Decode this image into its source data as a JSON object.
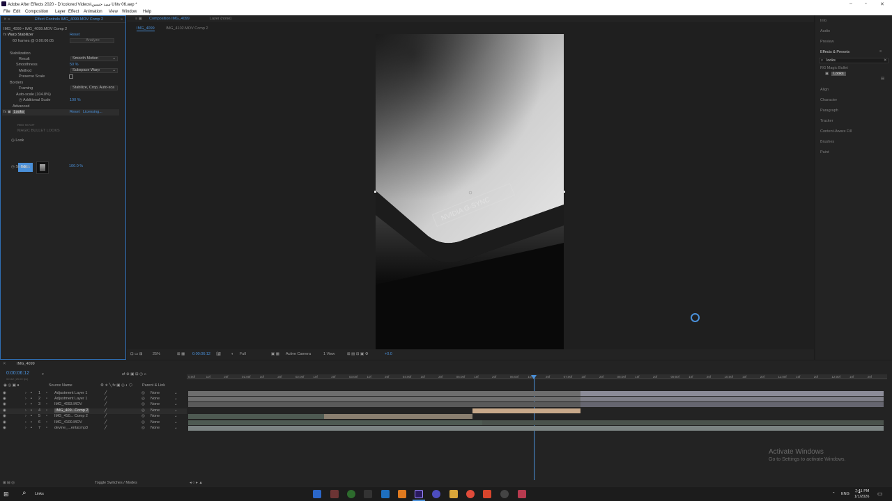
{
  "window": {
    "title": "Adobe After Effects 2020 - D:\\colored Videos\\سيد حسين UI\\tv 06.aep *"
  },
  "menu": [
    "File",
    "Edit",
    "Composition",
    "Layer",
    "Effect",
    "Animation",
    "View",
    "Window",
    "Help"
  ],
  "effect_controls": {
    "tab_label": "Effect Controls IMG_4099.MOV Comp 2",
    "header": "IMG_4099 • IMG_4099.MOV Comp 2",
    "warp": {
      "name": "Warp Stabilizer",
      "reset": "Reset",
      "frames_info": "60 frames @ 0:00:06:05",
      "analyze": "Analyze",
      "stabilization": "Stabilization",
      "result_label": "Result",
      "result_value": "Smooth Motion",
      "smoothness_label": "Smoothness",
      "smoothness_value": "50 %",
      "method_label": "Method",
      "method_value": "Subspace Warp",
      "preserve_scale": "Preserve Scale",
      "borders": "Borders",
      "framing_label": "Framing",
      "framing_value": "Stabilize, Crop, Auto-sca",
      "autoscale": "Auto-scale (104.8%)",
      "additional_scale_label": "Additional Scale",
      "additional_scale_value": "100 %",
      "advanced": "Advanced"
    },
    "looks": {
      "name": "Looks",
      "reset": "Reset",
      "licensing": "Licensing...",
      "rg_brand": "RED GIANT",
      "product": "MAGIC BULLET LOOKS",
      "look_label": "Look",
      "edit_label": "Edit...",
      "strength_label": "Strength",
      "strength_value": "100.0 %"
    }
  },
  "composition_panel": {
    "tab_label": "Composition IMG_4099",
    "layer_tab": "Layer (none)",
    "sub_tabs": [
      "IMG_4099",
      "IMG_4102.MOV Comp 2"
    ],
    "footer": {
      "zoom": "25%",
      "timecode": "0:00:06:12",
      "resolution": "Full",
      "camera": "Active Camera",
      "views": "1 View",
      "exposure": "+0.0"
    },
    "watermark_text": "NVIDIA  G-SYNC"
  },
  "right_panel": {
    "items_top": [
      "Info",
      "Audio",
      "Preview"
    ],
    "effects_presets": {
      "title": "Effects & Presets",
      "search_value": "looks",
      "folder": "RG Magic Bullet",
      "effect": "Looks"
    },
    "items_bottom": [
      "Align",
      "Character",
      "Paragraph",
      "Tracker",
      "Content-Aware Fill",
      "Brushes",
      "Paint"
    ]
  },
  "timeline": {
    "comp_tab": "IMG_4099",
    "current_time": "0:00:06:12",
    "frame_info": "00162 (25.00 fps)",
    "columns": {
      "source_name": "Source Name",
      "parent_link": "Parent & Link"
    },
    "layers": [
      {
        "num": "1",
        "name": "Adjustment Layer 1",
        "parent": "None"
      },
      {
        "num": "2",
        "name": "Adjustment Layer 1",
        "parent": "None"
      },
      {
        "num": "3",
        "name": "IMG_4093.MOV",
        "parent": "None"
      },
      {
        "num": "4",
        "name": "IMG_409...Comp 2",
        "parent": "None"
      },
      {
        "num": "5",
        "name": "IMG_410... Comp 2",
        "parent": "None"
      },
      {
        "num": "6",
        "name": "IMG_4100.MOV",
        "parent": "None"
      },
      {
        "num": "7",
        "name": "devine_...ental.mp3",
        "parent": "None"
      }
    ],
    "ruler_ticks": [
      "0:00f",
      "10f",
      "20f",
      "01:00f",
      "10f",
      "20f",
      "02:00f",
      "10f",
      "20f",
      "03:00f",
      "10f",
      "20f",
      "04:00f",
      "10f",
      "20f",
      "05:00f",
      "10f",
      "20f",
      "06:00f",
      "10f",
      "20f",
      "07:00f",
      "10f",
      "20f",
      "08:00f",
      "10f",
      "20f",
      "09:00f",
      "10f",
      "20f",
      "10:00f",
      "10f",
      "20f",
      "11:00f",
      "10f",
      "20f",
      "12:00f",
      "10f",
      "20f"
    ],
    "footer_label": "Toggle Switches / Modes"
  },
  "watermark": {
    "line1": "Activate Windows",
    "line2": "Go to Settings to activate Windows."
  },
  "taskbar": {
    "search_label": "Links",
    "lang": "ENG",
    "time": "7:41 PM",
    "date": "1/1/2026"
  },
  "colors": {
    "accent": "#4a90d9",
    "panel": "#232323",
    "viewer_bg": "#1f1f1f",
    "audio_bar": "#9a9aa8",
    "selected_bar": "#c8a98a"
  }
}
